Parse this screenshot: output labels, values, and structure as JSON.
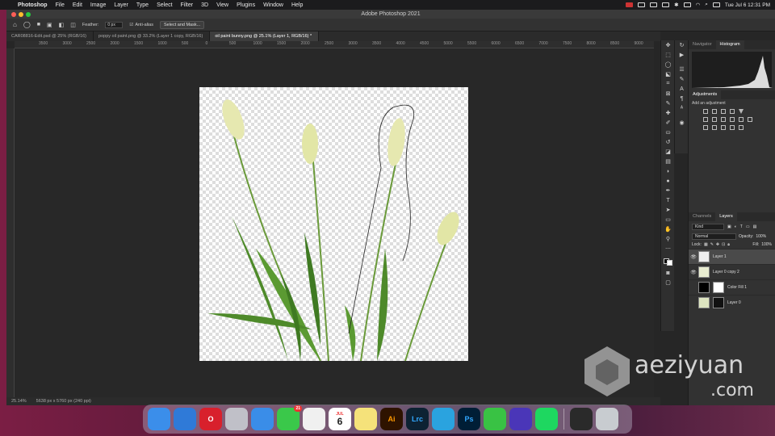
{
  "menubar": {
    "app_name": "Photoshop",
    "items": [
      "File",
      "Edit",
      "Image",
      "Layer",
      "Type",
      "Select",
      "Filter",
      "3D",
      "View",
      "Plugins",
      "Window",
      "Help"
    ],
    "clock": "Tue Jul 6  12:31 PM"
  },
  "window": {
    "title": "Adobe Photoshop 2021"
  },
  "options_bar": {
    "feather_label": "Feather:",
    "feather_value": "0 px",
    "anti_alias_label": "Anti-alias",
    "select_mask_label": "Select and Mask..."
  },
  "tabs": [
    {
      "label": "CAR08816-Edit.psd @ 25% (RGB/16)",
      "active": false
    },
    {
      "label": "poppy oil paint.png @ 33.2% (Layer 1 copy, RGB/16)",
      "active": false
    },
    {
      "label": "oil paint bunny.png @ 25.1% (Layer 1, RGB/16) *",
      "active": true
    }
  ],
  "ruler_labels": [
    "3500",
    "3000",
    "2500",
    "2000",
    "1500",
    "1000",
    "500",
    "0",
    "500",
    "1000",
    "1500",
    "2000",
    "2500",
    "3000",
    "3500",
    "4000",
    "4500",
    "5000",
    "5500",
    "6000",
    "6500",
    "7000",
    "7500",
    "8000",
    "8500",
    "9000"
  ],
  "status": {
    "zoom": "25.14%",
    "doc_info": "5638 px x 5760 px (240 ppi)"
  },
  "panels": {
    "top_tabs": [
      "Navigator",
      "Histogram"
    ],
    "adjustments_title": "Adjustments",
    "adjustments_hint": "Add an adjustment",
    "layer_tabs": [
      "Channels",
      "Layers"
    ],
    "kind_label": "Kind",
    "blend_mode": "Normal",
    "opacity_label": "Opacity:",
    "opacity_value": "100%",
    "lock_label": "Lock:",
    "fill_label": "Fill:",
    "fill_value": "100%",
    "layers": [
      {
        "name": "Layer 1",
        "selected": true,
        "visible": true
      },
      {
        "name": "Layer 0 copy 2",
        "selected": false,
        "visible": true
      },
      {
        "name": "Color Fill 1",
        "selected": false,
        "visible": false
      },
      {
        "name": "Layer 0",
        "selected": false,
        "visible": false
      }
    ]
  },
  "dock": {
    "apps": [
      {
        "name": "Finder",
        "label": "",
        "color": "#3b8eea"
      },
      {
        "name": "Safari",
        "label": "",
        "color": "#2f7ad8"
      },
      {
        "name": "Opera",
        "label": "O",
        "color": "#d8202c"
      },
      {
        "name": "Launchpad",
        "label": "",
        "color": "#c0c0c8"
      },
      {
        "name": "Mail",
        "label": "",
        "color": "#3a8de8"
      },
      {
        "name": "Messages",
        "label": "",
        "color": "#3ac84a",
        "badge": "21"
      },
      {
        "name": "Photos",
        "label": "",
        "color": "#f0f0f0"
      },
      {
        "name": "Calendar",
        "label": "6",
        "color": "#ffffff",
        "month": "JUL"
      },
      {
        "name": "Notes",
        "label": "",
        "color": "#f5e27a"
      },
      {
        "name": "Illustrator",
        "label": "Ai",
        "color": "#2e1300"
      },
      {
        "name": "Lightroom Classic",
        "label": "Lrc",
        "color": "#0d2233"
      },
      {
        "name": "Telegram",
        "label": "",
        "color": "#2aa3df"
      },
      {
        "name": "Photoshop",
        "label": "Ps",
        "color": "#001e36"
      },
      {
        "name": "Camo",
        "label": "",
        "color": "#39c244"
      },
      {
        "name": "Dropbox",
        "label": "",
        "color": "#4a36b8"
      },
      {
        "name": "Spotify",
        "label": "",
        "color": "#1ed760"
      },
      {
        "name": "Screen",
        "label": "",
        "color": "#2a2a2a"
      },
      {
        "name": "Trash",
        "label": "",
        "color": "#c8ccd0"
      }
    ]
  },
  "watermark": {
    "line1": "aeziyuan",
    "line2": ".com"
  }
}
